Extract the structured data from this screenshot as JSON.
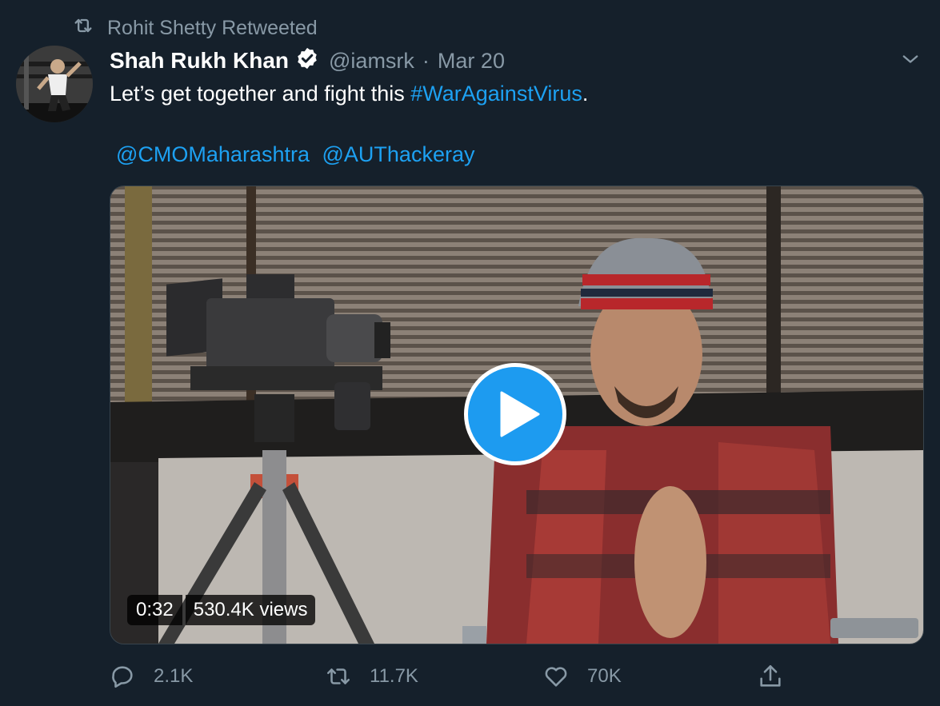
{
  "retweet_context": {
    "text": "Rohit Shetty Retweeted",
    "icon": "retweet-icon"
  },
  "author": {
    "display_name": "Shah Rukh Khan",
    "handle": "@iamsrk",
    "separator": "·",
    "date": "Mar 20",
    "verified": true
  },
  "tweet": {
    "text_before": "Let’s get together and fight this ",
    "hashtag": "#WarAgainstVirus",
    "text_after": ".",
    "mentions": [
      "@CMOMaharashtra",
      "@AUThackeray"
    ]
  },
  "video": {
    "duration": "0:32",
    "views": "530.4K views",
    "play_icon": "play-icon"
  },
  "actions": {
    "reply_count": "2.1K",
    "retweet_count": "11.7K",
    "like_count": "70K"
  },
  "colors": {
    "background": "#15202b",
    "accent": "#1da1f2",
    "muted": "#8899a6"
  }
}
